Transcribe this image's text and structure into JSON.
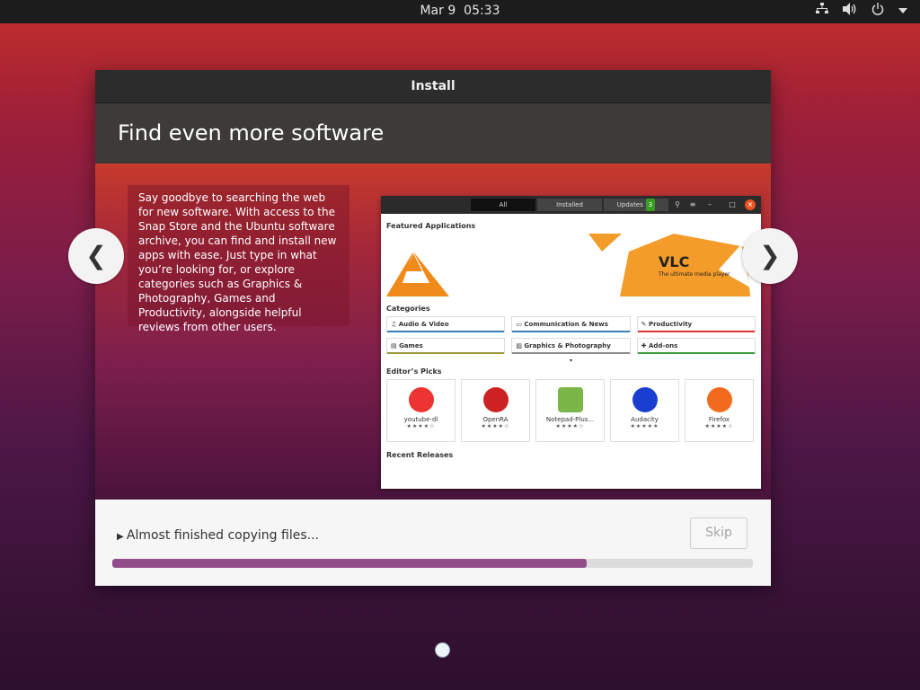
{
  "topbar": {
    "date": "Mar 9",
    "time": "05:33"
  },
  "window": {
    "title": "Install"
  },
  "slide": {
    "heading": "Find even more software",
    "description": "Say goodbye to searching the web for new software. With access to the Snap Store and the Ubuntu software archive, you can find and install new apps with ease. Just type in what you’re looking for, or explore categories such as Graphics & Photography, Games and Productivity, alongside helpful reviews from other users."
  },
  "software_shot": {
    "tabs": {
      "all": "All",
      "installed": "Installed",
      "updates": "Updates",
      "updates_count": "3"
    },
    "featured_title": "Featured Applications",
    "banner": {
      "name": "VLC",
      "tagline": "The ultimate media player"
    },
    "categories_title": "Categories",
    "categories": [
      {
        "label": "Audio & Video",
        "color": "#3b7fb6"
      },
      {
        "label": "Communication & News",
        "color": "#3b7fb6"
      },
      {
        "label": "Productivity",
        "color": "#d33"
      },
      {
        "label": "Games",
        "color": "#9a9a3a"
      },
      {
        "label": "Graphics & Photography",
        "color": "#8a8a8a"
      },
      {
        "label": "Add-ons",
        "color": "#3a9d3a"
      }
    ],
    "picks_title": "Editor’s Picks",
    "picks": [
      {
        "name": "youtube-dl",
        "stars": "★★★★☆",
        "color": "#e33"
      },
      {
        "name": "OpenRA",
        "stars": "★★★★☆",
        "color": "#c22"
      },
      {
        "name": "Notepad-Plus...",
        "stars": "★★★★☆",
        "color": "#7ab648"
      },
      {
        "name": "Audacity",
        "stars": "★★★★★",
        "color": "#1a3fd0"
      },
      {
        "name": "Firefox",
        "stars": "★★★★☆",
        "color": "#f26b1d"
      }
    ],
    "recent_title": "Recent Releases"
  },
  "progress": {
    "status": "Almost finished copying files...",
    "percent": 74,
    "skip_label": "Skip"
  },
  "arrows": {
    "left": "❮",
    "right": "❯"
  }
}
